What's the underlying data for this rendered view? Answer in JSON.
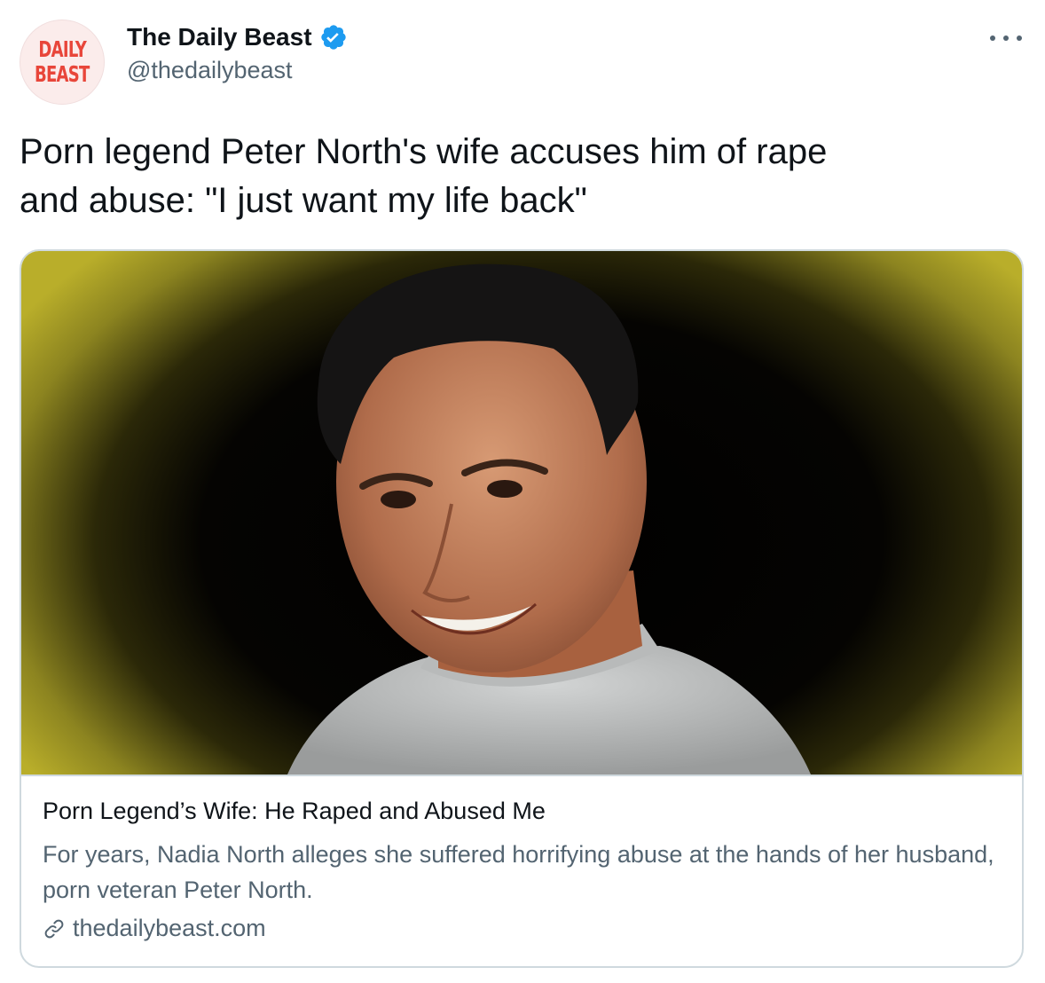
{
  "tweet": {
    "author": {
      "name": "The Daily Beast",
      "handle": "@thedailybeast",
      "avatar_logo_lines": [
        "DAILY",
        "BEAST"
      ],
      "verified": true
    },
    "more_icon": "more-horizontal-icon",
    "text_lines": [
      "Porn legend Peter North's wife accuses him of rape",
      "and abuse: \"I just want my life back\""
    ],
    "card": {
      "image_subject": "photo of a smiling man in a grey t-shirt against a black and yellow background",
      "title": "Porn Legend’s Wife: He Raped and Abused Me",
      "description": "For years, Nadia North alleges she suffered horrifying abuse at the hands of her husband, porn veteran Peter North.",
      "domain": "thedailybeast.com",
      "link_icon": "link-icon"
    }
  },
  "colors": {
    "text_primary": "#0f1419",
    "text_secondary": "#536471",
    "border": "#cfd9de",
    "verified_blue": "#1d9bf0",
    "logo_red": "#e8463a"
  }
}
